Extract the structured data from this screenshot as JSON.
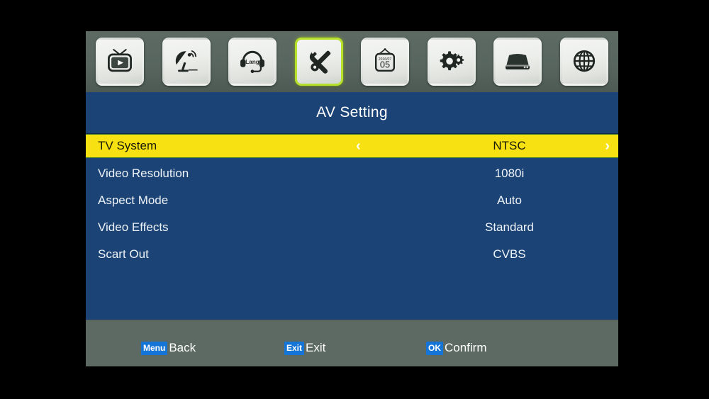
{
  "topbar": {
    "icons": [
      {
        "name": "tv-play-icon",
        "label": "TV",
        "selected": false
      },
      {
        "name": "satellite-dish-icon",
        "label": "Installation",
        "selected": false
      },
      {
        "name": "headset-lang-icon",
        "label": "Lang",
        "selected": false
      },
      {
        "name": "tools-wrench-screwdriver-icon",
        "label": "AV Setting",
        "selected": true
      },
      {
        "name": "calendar-icon",
        "label": "Timer",
        "selected": false
      },
      {
        "name": "gears-icon",
        "label": "System Setting",
        "selected": false
      },
      {
        "name": "hard-disk-icon",
        "label": "USB / HDD",
        "selected": false
      },
      {
        "name": "globe-icon",
        "label": "Network",
        "selected": false
      }
    ],
    "calendar": {
      "year_month": "2016/07",
      "day": "05"
    },
    "headset_text": "Lang"
  },
  "title": "AV Setting",
  "menu": {
    "rows": [
      {
        "label": "TV System",
        "value": "NTSC",
        "selected": true
      },
      {
        "label": "Video Resolution",
        "value": "1080i",
        "selected": false
      },
      {
        "label": "Aspect Mode",
        "value": "Auto",
        "selected": false
      },
      {
        "label": "Video Effects",
        "value": "Standard",
        "selected": false
      },
      {
        "label": "Scart Out",
        "value": "CVBS",
        "selected": false
      }
    ],
    "left_arrow": "‹",
    "right_arrow": "›"
  },
  "footer": {
    "hints": [
      {
        "key": "Menu",
        "action": "Back"
      },
      {
        "key": "Exit",
        "action": "Exit"
      },
      {
        "key": "OK",
        "action": "Confirm"
      }
    ]
  },
  "colors": {
    "panel_blue": "#1b4375",
    "highlight_yellow": "#f7e113",
    "bar_gray": "#5c6a63",
    "selected_border_green": "#b6e02a",
    "key_badge_blue": "#1575d6",
    "background_black": "#000000"
  }
}
